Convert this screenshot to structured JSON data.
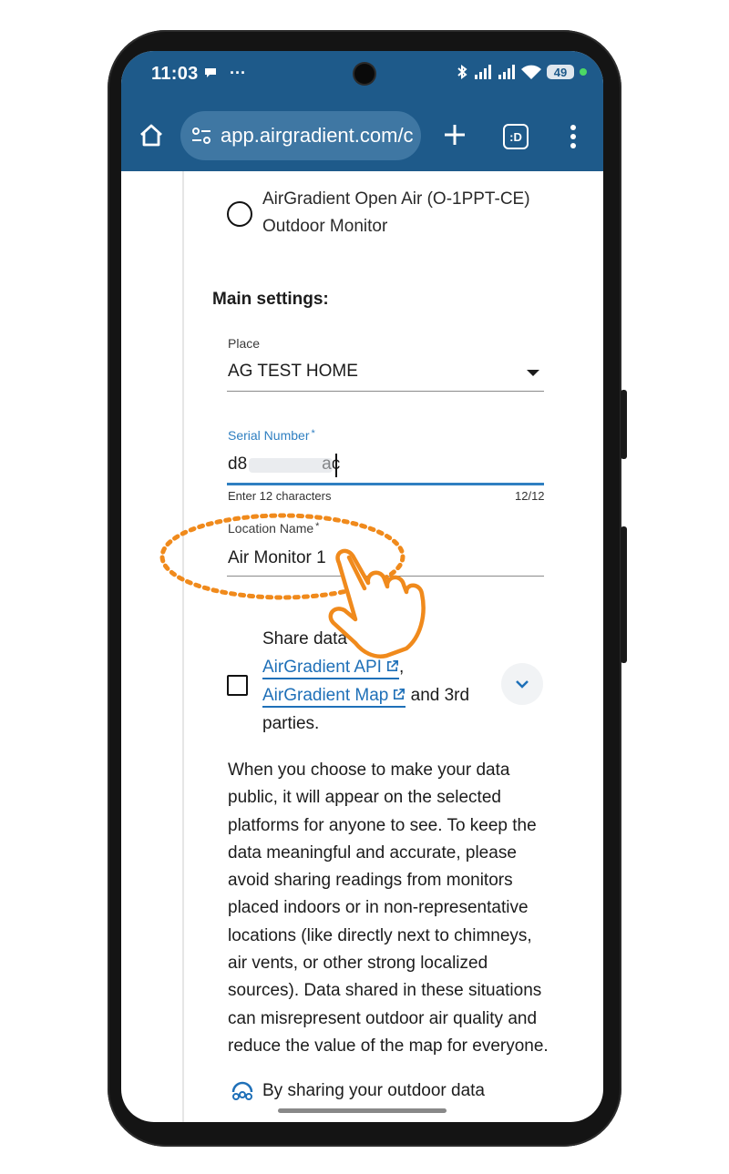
{
  "status_bar": {
    "time": "11:03",
    "left_icons": [
      "chat-bubble-icon",
      "more-dots-icon"
    ],
    "right_icons": [
      "bluetooth-icon",
      "signal-icon",
      "signal-icon",
      "wifi-icon"
    ],
    "battery": "49"
  },
  "browser": {
    "url": "app.airgradient.com/c",
    "tab_count_label": ":D"
  },
  "device_option": {
    "label": "AirGradient Open Air (O-1PPT-CE) Outdoor Monitor"
  },
  "main_settings": {
    "title": "Main settings:",
    "place": {
      "label": "Place",
      "value": "AG TEST HOME"
    },
    "serial": {
      "label": "Serial Number",
      "required_mark": "*",
      "value_prefix": "d8",
      "value_suffix": "ac",
      "helper": "Enter 12 characters",
      "counter": "12/12"
    },
    "location": {
      "label": "Location Name",
      "required_mark": "*",
      "value": "Air Monitor 1"
    }
  },
  "share": {
    "prefix": "Share data w",
    "link_api": "AirGradient API",
    "separator": ",",
    "link_map": "AirGradient Map",
    "suffix": " and 3rd parties."
  },
  "disclaimer": "When you choose to make your data public, it will appear on the selected platforms for anyone to see. To keep the data meaningful and accurate, please avoid sharing readings from monitors placed indoors or in non-representative locations (like directly next to chimneys, air vents, or other strong localized sources). Data shared in these situations can misrepresent outdoor air quality and reduce the value of the map for everyone.",
  "bottom_note": "By sharing your outdoor data",
  "colors": {
    "toolbar": "#1e5a8a",
    "accent": "#2f7fc1",
    "link": "#1f70b8",
    "annotation": "#f08a1c"
  }
}
